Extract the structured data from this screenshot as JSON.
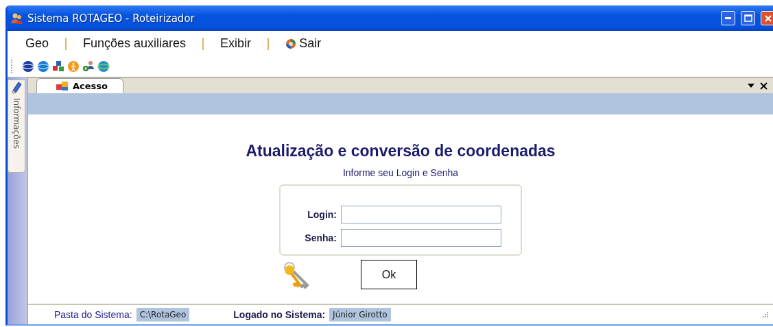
{
  "window": {
    "title": "Sistema ROTAGEO - Roteirizador"
  },
  "menu": [
    {
      "label": "Geo",
      "kind": "text"
    },
    {
      "label": "Funções auxiliares",
      "kind": "text"
    },
    {
      "label": "Exibir",
      "kind": "text"
    },
    {
      "label": "Sair",
      "kind": "icon"
    }
  ],
  "side_tab": {
    "label": "Informações"
  },
  "doc_tabs": [
    {
      "label": "Acesso",
      "selected": true
    }
  ],
  "form": {
    "heading": "Atualização e conversão de coordenadas",
    "subtitle": "Informe seu Login e Senha",
    "fields": [
      {
        "label": "Login:"
      },
      {
        "label": "Senha:"
      }
    ],
    "button": "Ok"
  },
  "status_bar": [
    {
      "label": "Pasta do Sistema:",
      "value": "C:\\RotaGeo",
      "bold": false
    },
    {
      "label": "Logado no Sistema:",
      "value": "Júnior Girotto",
      "bold": true
    }
  ]
}
